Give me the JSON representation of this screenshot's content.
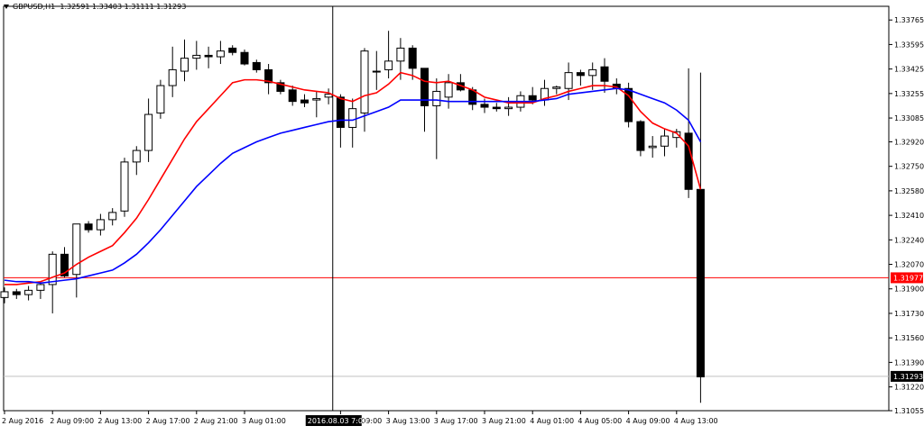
{
  "header": {
    "symbol": "GBPUSD,H1",
    "ohlc": "1.32591 1.33403 1.31111 1.31293"
  },
  "colors": {
    "background": "#ffffff",
    "fast_ma": "#ff0000",
    "slow_ma": "#0000ff",
    "candle_up": "#ffffff",
    "candle_down": "#000000",
    "hline": "#ff0000"
  },
  "crosshair": {
    "time_label": "2016.08.03 7:00",
    "x_index": 27.35
  },
  "chart_data": {
    "type": "candlestick",
    "title": "GBPUSD,H1",
    "ylim": [
      1.31055,
      1.3386
    ],
    "yticks": [
      1.33765,
      1.33595,
      1.33425,
      1.33255,
      1.33085,
      1.3292,
      1.3275,
      1.3258,
      1.3241,
      1.3224,
      1.3207,
      1.319,
      1.3173,
      1.3156,
      1.3139,
      1.3122,
      1.31055
    ],
    "xticks": [
      {
        "index": 0,
        "label": "2 Aug 2016"
      },
      {
        "index": 4,
        "label": "2 Aug 09:00"
      },
      {
        "index": 8,
        "label": "2 Aug 13:00"
      },
      {
        "index": 12,
        "label": "2 Aug 17:00"
      },
      {
        "index": 16,
        "label": "2 Aug 21:00"
      },
      {
        "index": 20,
        "label": "3 Aug 01:00"
      },
      {
        "index": 28,
        "label": "3 Aug 09:00"
      },
      {
        "index": 32,
        "label": "3 Aug 13:00"
      },
      {
        "index": 36,
        "label": "3 Aug 17:00"
      },
      {
        "index": 40,
        "label": "3 Aug 21:00"
      },
      {
        "index": 44,
        "label": "4 Aug 01:00"
      },
      {
        "index": 48,
        "label": "4 Aug 05:00"
      },
      {
        "index": 52,
        "label": "4 Aug 09:00"
      },
      {
        "index": 56,
        "label": "4 Aug 13:00"
      }
    ],
    "candles": [
      [
        1.3184,
        1.3191,
        1.318,
        1.3188
      ],
      [
        1.3188,
        1.319,
        1.3183,
        1.3186
      ],
      [
        1.3186,
        1.3192,
        1.3182,
        1.3189
      ],
      [
        1.3189,
        1.3195,
        1.3183,
        1.3193
      ],
      [
        1.3193,
        1.3216,
        1.3173,
        1.3214
      ],
      [
        1.3214,
        1.3219,
        1.3198,
        1.3199
      ],
      [
        1.32,
        1.3234,
        1.3184,
        1.3235
      ],
      [
        1.3235,
        1.3237,
        1.3229,
        1.3231
      ],
      [
        1.3231,
        1.3242,
        1.3227,
        1.3238
      ],
      [
        1.3238,
        1.3246,
        1.3234,
        1.3243
      ],
      [
        1.3244,
        1.3281,
        1.324,
        1.3278
      ],
      [
        1.3278,
        1.3289,
        1.3269,
        1.3286
      ],
      [
        1.3286,
        1.3322,
        1.3278,
        1.3311
      ],
      [
        1.3312,
        1.3335,
        1.3308,
        1.3331
      ],
      [
        1.3331,
        1.3358,
        1.3323,
        1.3342
      ],
      [
        1.3341,
        1.3363,
        1.3334,
        1.335
      ],
      [
        1.335,
        1.3362,
        1.3342,
        1.3352
      ],
      [
        1.3352,
        1.3358,
        1.3343,
        1.3351
      ],
      [
        1.3351,
        1.3362,
        1.3346,
        1.3355
      ],
      [
        1.3357,
        1.3359,
        1.3352,
        1.3354
      ],
      [
        1.3354,
        1.3356,
        1.3345,
        1.3346
      ],
      [
        1.3347,
        1.3349,
        1.334,
        1.3342
      ],
      [
        1.3342,
        1.3346,
        1.3325,
        1.3333
      ],
      [
        1.3333,
        1.3335,
        1.3325,
        1.3327
      ],
      [
        1.3328,
        1.3331,
        1.3317,
        1.332
      ],
      [
        1.3321,
        1.3325,
        1.3316,
        1.3319
      ],
      [
        1.3321,
        1.3327,
        1.3309,
        1.3322
      ],
      [
        1.3323,
        1.3329,
        1.3318,
        1.3325
      ],
      [
        1.3323,
        1.3325,
        1.3288,
        1.3302
      ],
      [
        1.3302,
        1.3322,
        1.3288,
        1.3315
      ],
      [
        1.3312,
        1.3357,
        1.3299,
        1.3355
      ],
      [
        1.3341,
        1.3355,
        1.3328,
        1.3341
      ],
      [
        1.3342,
        1.3369,
        1.3336,
        1.3348
      ],
      [
        1.3348,
        1.3364,
        1.3335,
        1.3357
      ],
      [
        1.3357,
        1.3359,
        1.3335,
        1.3343
      ],
      [
        1.3343,
        1.3343,
        1.3299,
        1.3317
      ],
      [
        1.3317,
        1.3336,
        1.328,
        1.3327
      ],
      [
        1.3323,
        1.3339,
        1.3315,
        1.3333
      ],
      [
        1.3333,
        1.3339,
        1.3327,
        1.3328
      ],
      [
        1.3328,
        1.333,
        1.3314,
        1.3318
      ],
      [
        1.3318,
        1.3322,
        1.3312,
        1.3316
      ],
      [
        1.3316,
        1.3319,
        1.3313,
        1.3315
      ],
      [
        1.3315,
        1.3323,
        1.331,
        1.3316
      ],
      [
        1.3316,
        1.3327,
        1.3313,
        1.3324
      ],
      [
        1.3324,
        1.333,
        1.3318,
        1.3321
      ],
      [
        1.3321,
        1.3335,
        1.3317,
        1.3329
      ],
      [
        1.3329,
        1.3331,
        1.3325,
        1.333
      ],
      [
        1.3329,
        1.3347,
        1.3321,
        1.334
      ],
      [
        1.334,
        1.3342,
        1.3331,
        1.3338
      ],
      [
        1.3338,
        1.3347,
        1.3328,
        1.3342
      ],
      [
        1.3344,
        1.335,
        1.3326,
        1.3334
      ],
      [
        1.3332,
        1.3336,
        1.3325,
        1.3329
      ],
      [
        1.3329,
        1.3333,
        1.3302,
        1.3306
      ],
      [
        1.3306,
        1.3307,
        1.3282,
        1.3286
      ],
      [
        1.3288,
        1.3296,
        1.3281,
        1.3289
      ],
      [
        1.3289,
        1.3301,
        1.3282,
        1.3296
      ],
      [
        1.3295,
        1.3301,
        1.3288,
        1.3299
      ],
      [
        1.3298,
        1.3343,
        1.3253,
        1.3259
      ],
      [
        1.3259,
        1.334,
        1.3111,
        1.3129
      ]
    ],
    "series": [
      {
        "name": "",
        "color": "#ff0000",
        "values": [
          1.3193,
          1.3193,
          1.3194,
          1.3195,
          1.3198,
          1.3201,
          1.3207,
          1.3212,
          1.3216,
          1.322,
          1.3229,
          1.3239,
          1.3252,
          1.3266,
          1.328,
          1.3294,
          1.3306,
          1.3315,
          1.3324,
          1.3333,
          1.3335,
          1.3335,
          1.3334,
          1.3332,
          1.333,
          1.3328,
          1.3327,
          1.3326,
          1.3322,
          1.332,
          1.3324,
          1.3326,
          1.3332,
          1.334,
          1.3338,
          1.3334,
          1.3333,
          1.3334,
          1.3331,
          1.3328,
          1.3323,
          1.3321,
          1.3319,
          1.3319,
          1.3319,
          1.3322,
          1.3324,
          1.3327,
          1.3329,
          1.3331,
          1.3331,
          1.333,
          1.3324,
          1.3313,
          1.3305,
          1.3301,
          1.3298,
          1.3289,
          1.3259
        ]
      },
      {
        "name": "",
        "color": "#0000ff",
        "values": [
          1.3196,
          1.3195,
          1.3195,
          1.3194,
          1.3195,
          1.3196,
          1.3197,
          1.3199,
          1.3201,
          1.3203,
          1.3208,
          1.3214,
          1.3222,
          1.3231,
          1.3241,
          1.3251,
          1.3261,
          1.3269,
          1.3277,
          1.3284,
          1.3288,
          1.3292,
          1.3295,
          1.3298,
          1.33,
          1.3302,
          1.3304,
          1.3306,
          1.3307,
          1.3307,
          1.331,
          1.3313,
          1.3316,
          1.3321,
          1.3321,
          1.3321,
          1.3321,
          1.332,
          1.332,
          1.332,
          1.332,
          1.332,
          1.332,
          1.332,
          1.332,
          1.3321,
          1.3322,
          1.3325,
          1.3326,
          1.3327,
          1.3328,
          1.3329,
          1.3328,
          1.3325,
          1.3322,
          1.3319,
          1.3314,
          1.3307,
          1.3292
        ]
      }
    ],
    "hlines": [
      {
        "value": 1.31977,
        "label": "1.31977",
        "color": "#ff0000"
      },
      {
        "value": 1.31293,
        "label": "1.31293",
        "color": "#c0c0c0"
      }
    ]
  }
}
